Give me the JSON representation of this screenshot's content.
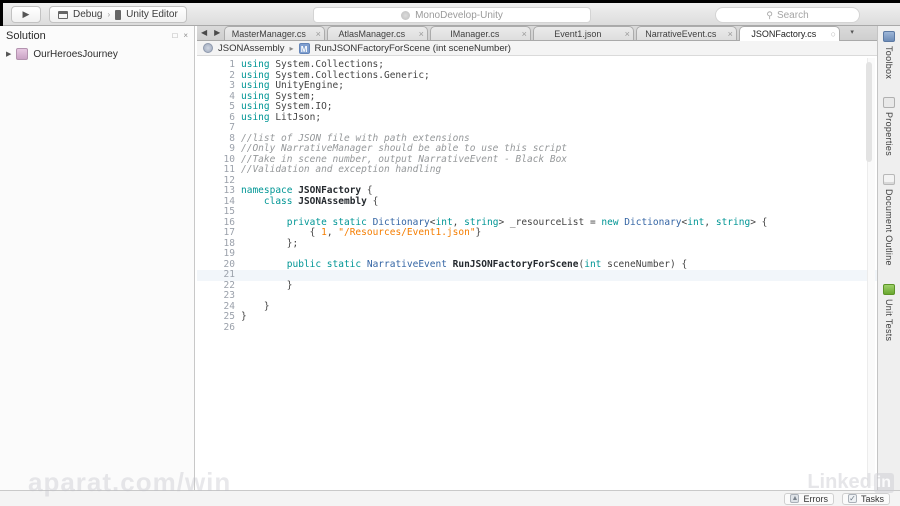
{
  "colors": {
    "keyword": "#009695",
    "type": "#3465a4",
    "string": "#f57d00",
    "comment": "#95989a",
    "line_number": "#9ba1ab"
  },
  "icons": {
    "play": "▶",
    "back": "◀",
    "forward": "▶",
    "close": "×",
    "modified_dot": "○",
    "dropdown": "▾",
    "breadcrumb_sep": "▸",
    "expander": "▶",
    "method_badge": "M",
    "search": "⌕",
    "warning": "▲",
    "check": "✓",
    "dock": "□",
    "panel_close": "×",
    "segment_sep": "›"
  },
  "topbar": {
    "debug_label": "Debug",
    "target_label": "Unity Editor",
    "app_title": "MonoDevelop-Unity",
    "search_placeholder": "Search"
  },
  "solution_panel": {
    "title": "Solution",
    "items": [
      {
        "label": "OurHeroesJourney"
      }
    ]
  },
  "editor": {
    "tabs": [
      {
        "label": "MasterManager.cs",
        "active": false
      },
      {
        "label": "AtlasManager.cs",
        "active": false
      },
      {
        "label": "IManager.cs",
        "active": false
      },
      {
        "label": "Event1.json",
        "active": false
      },
      {
        "label": "NarrativeEvent.cs",
        "active": false
      },
      {
        "label": "JSONFactory.cs",
        "active": true
      }
    ],
    "breadcrumb": {
      "assembly": "JSONAssembly",
      "member": "RunJSONFactoryForScene (int sceneNumber)"
    }
  },
  "right_tabs": [
    {
      "label": "Toolbox",
      "icon": "toolbox-icon",
      "cls": "toolbox"
    },
    {
      "label": "Properties",
      "icon": "properties-icon",
      "cls": "properties"
    },
    {
      "label": "Document Outline",
      "icon": "document-outline-icon",
      "cls": "doc-outline"
    },
    {
      "label": "Unit Tests",
      "icon": "unit-tests-icon",
      "cls": "unit-tests"
    }
  ],
  "statusbar": {
    "errors_label": "Errors",
    "tasks_label": "Tasks"
  },
  "watermarks": {
    "bottom_left": "aparat.com/win",
    "bottom_right_text": "Linked",
    "bottom_right_badge": "in"
  },
  "code": {
    "current_line": 21,
    "lines": [
      {
        "n": 1,
        "segs": [
          [
            "kw",
            "using "
          ],
          [
            "pl",
            "System.Collections;"
          ]
        ]
      },
      {
        "n": 2,
        "segs": [
          [
            "kw",
            "using "
          ],
          [
            "pl",
            "System.Collections.Generic;"
          ]
        ]
      },
      {
        "n": 3,
        "segs": [
          [
            "kw",
            "using "
          ],
          [
            "pl",
            "UnityEngine;"
          ]
        ]
      },
      {
        "n": 4,
        "segs": [
          [
            "kw",
            "using "
          ],
          [
            "pl",
            "System;"
          ]
        ]
      },
      {
        "n": 5,
        "segs": [
          [
            "kw",
            "using "
          ],
          [
            "pl",
            "System.IO;"
          ]
        ]
      },
      {
        "n": 6,
        "segs": [
          [
            "kw",
            "using "
          ],
          [
            "pl",
            "LitJson;"
          ]
        ]
      },
      {
        "n": 7,
        "segs": []
      },
      {
        "n": 8,
        "segs": [
          [
            "cm",
            "//list of JSON file with path extensions"
          ]
        ]
      },
      {
        "n": 9,
        "segs": [
          [
            "cm",
            "//Only NarrativeManager should be able to use this script"
          ]
        ]
      },
      {
        "n": 10,
        "segs": [
          [
            "cm",
            "//Take in scene number, output NarrativeEvent - Black Box"
          ]
        ]
      },
      {
        "n": 11,
        "segs": [
          [
            "cm",
            "//Validation and exception handling"
          ]
        ]
      },
      {
        "n": 12,
        "segs": []
      },
      {
        "n": 13,
        "segs": [
          [
            "kw",
            "namespace "
          ],
          [
            "de",
            "JSONFactory"
          ],
          [
            "pl",
            " {"
          ]
        ]
      },
      {
        "n": 14,
        "segs": [
          [
            "pl",
            "    "
          ],
          [
            "kw",
            "class "
          ],
          [
            "de",
            "JSONAssembly"
          ],
          [
            "pl",
            " {"
          ]
        ]
      },
      {
        "n": 15,
        "segs": []
      },
      {
        "n": 16,
        "segs": [
          [
            "pl",
            "        "
          ],
          [
            "kw",
            "private static "
          ],
          [
            "ty",
            "Dictionary"
          ],
          [
            "pl",
            "<"
          ],
          [
            "kw",
            "int"
          ],
          [
            "pl",
            ", "
          ],
          [
            "kw",
            "string"
          ],
          [
            "pl",
            "> _resourceList = "
          ],
          [
            "kw",
            "new "
          ],
          [
            "ty",
            "Dictionary"
          ],
          [
            "pl",
            "<"
          ],
          [
            "kw",
            "int"
          ],
          [
            "pl",
            ", "
          ],
          [
            "kw",
            "string"
          ],
          [
            "pl",
            "> {"
          ]
        ]
      },
      {
        "n": 17,
        "segs": [
          [
            "pl",
            "            { "
          ],
          [
            "nu",
            "1"
          ],
          [
            "pl",
            ", "
          ],
          [
            "st",
            "\"/Resources/Event1.json\""
          ],
          [
            "pl",
            "}"
          ]
        ]
      },
      {
        "n": 18,
        "segs": [
          [
            "pl",
            "        };"
          ]
        ]
      },
      {
        "n": 19,
        "segs": []
      },
      {
        "n": 20,
        "segs": [
          [
            "pl",
            "        "
          ],
          [
            "kw",
            "public static "
          ],
          [
            "ty",
            "NarrativeEvent "
          ],
          [
            "de",
            "RunJSONFactoryForScene"
          ],
          [
            "pl",
            "("
          ],
          [
            "kw",
            "int"
          ],
          [
            "pl",
            " sceneNumber) {"
          ]
        ]
      },
      {
        "n": 21,
        "segs": []
      },
      {
        "n": 22,
        "segs": [
          [
            "pl",
            "        }"
          ]
        ]
      },
      {
        "n": 23,
        "segs": []
      },
      {
        "n": 24,
        "segs": [
          [
            "pl",
            "    }"
          ]
        ]
      },
      {
        "n": 25,
        "segs": [
          [
            "pl",
            "}"
          ]
        ]
      },
      {
        "n": 26,
        "segs": []
      }
    ]
  }
}
